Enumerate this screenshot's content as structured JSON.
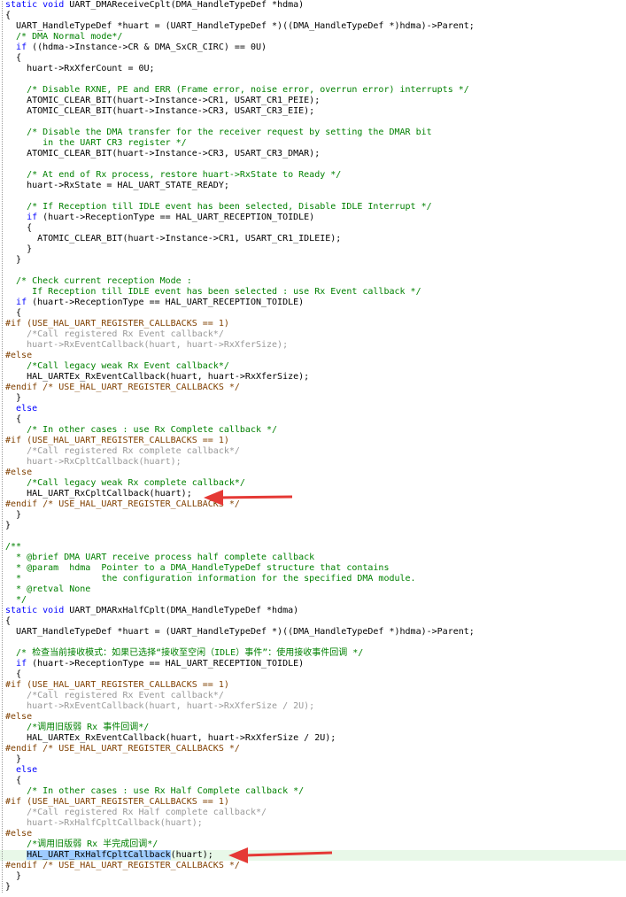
{
  "editor": {
    "lines": [
      {
        "t": "static void UART_DMAReceiveCplt(DMA_HandleTypeDef *hdma)",
        "c": "kw"
      },
      {
        "t": "{",
        "c": ""
      },
      {
        "t": "  UART_HandleTypeDef *huart = (UART_HandleTypeDef *)((DMA_HandleTypeDef *)hdma)->Parent;",
        "c": ""
      },
      {
        "t": "  /* DMA Normal mode*/",
        "c": "cm"
      },
      {
        "t": "  if ((hdma->Instance->CR & DMA_SxCR_CIRC) == 0U)",
        "c": "kw"
      },
      {
        "t": "  {",
        "c": ""
      },
      {
        "t": "    huart->RxXferCount = 0U;",
        "c": ""
      },
      {
        "t": "",
        "c": ""
      },
      {
        "t": "    /* Disable RXNE, PE and ERR (Frame error, noise error, overrun error) interrupts */",
        "c": "cm"
      },
      {
        "t": "    ATOMIC_CLEAR_BIT(huart->Instance->CR1, USART_CR1_PEIE);",
        "c": ""
      },
      {
        "t": "    ATOMIC_CLEAR_BIT(huart->Instance->CR3, USART_CR3_EIE);",
        "c": ""
      },
      {
        "t": "",
        "c": ""
      },
      {
        "t": "    /* Disable the DMA transfer for the receiver request by setting the DMAR bit",
        "c": "cm"
      },
      {
        "t": "       in the UART CR3 register */",
        "c": "cm"
      },
      {
        "t": "    ATOMIC_CLEAR_BIT(huart->Instance->CR3, USART_CR3_DMAR);",
        "c": ""
      },
      {
        "t": "",
        "c": ""
      },
      {
        "t": "    /* At end of Rx process, restore huart->RxState to Ready */",
        "c": "cm"
      },
      {
        "t": "    huart->RxState = HAL_UART_STATE_READY;",
        "c": ""
      },
      {
        "t": "",
        "c": ""
      },
      {
        "t": "    /* If Reception till IDLE event has been selected, Disable IDLE Interrupt */",
        "c": "cm"
      },
      {
        "t": "    if (huart->ReceptionType == HAL_UART_RECEPTION_TOIDLE)",
        "c": "kw"
      },
      {
        "t": "    {",
        "c": ""
      },
      {
        "t": "      ATOMIC_CLEAR_BIT(huart->Instance->CR1, USART_CR1_IDLEIE);",
        "c": ""
      },
      {
        "t": "    }",
        "c": ""
      },
      {
        "t": "  }",
        "c": ""
      },
      {
        "t": "",
        "c": ""
      },
      {
        "t": "  /* Check current reception Mode :",
        "c": "cm"
      },
      {
        "t": "     If Reception till IDLE event has been selected : use Rx Event callback */",
        "c": "cm"
      },
      {
        "t": "  if (huart->ReceptionType == HAL_UART_RECEPTION_TOIDLE)",
        "c": "kw"
      },
      {
        "t": "  {",
        "c": ""
      },
      {
        "t": "#if (USE_HAL_UART_REGISTER_CALLBACKS == 1)",
        "c": "pp"
      },
      {
        "t": "    /*Call registered Rx Event callback*/",
        "c": "inactive"
      },
      {
        "t": "    huart->RxEventCallback(huart, huart->RxXferSize);",
        "c": "inactive"
      },
      {
        "t": "#else",
        "c": "pp"
      },
      {
        "t": "    /*Call legacy weak Rx Event callback*/",
        "c": "cm"
      },
      {
        "t": "    HAL_UARTEx_RxEventCallback(huart, huart->RxXferSize);",
        "c": ""
      },
      {
        "t": "#endif /* USE_HAL_UART_REGISTER_CALLBACKS */",
        "c": "pp"
      },
      {
        "t": "  }",
        "c": ""
      },
      {
        "t": "  else",
        "c": "kw"
      },
      {
        "t": "  {",
        "c": ""
      },
      {
        "t": "    /* In other cases : use Rx Complete callback */",
        "c": "cm"
      },
      {
        "t": "#if (USE_HAL_UART_REGISTER_CALLBACKS == 1)",
        "c": "pp"
      },
      {
        "t": "    /*Call registered Rx complete callback*/",
        "c": "inactive"
      },
      {
        "t": "    huart->RxCpltCallback(huart);",
        "c": "inactive"
      },
      {
        "t": "#else",
        "c": "pp"
      },
      {
        "t": "    /*Call legacy weak Rx complete callback*/",
        "c": "cm"
      },
      {
        "t": "    HAL_UART_RxCpltCallback(huart);",
        "c": ""
      },
      {
        "t": "#endif /* USE_HAL_UART_REGISTER_CALLBACKS */",
        "c": "pp"
      },
      {
        "t": "  }",
        "c": ""
      },
      {
        "t": "}",
        "c": ""
      },
      {
        "t": "",
        "c": ""
      },
      {
        "t": "/**",
        "c": "cm"
      },
      {
        "t": "  * @brief DMA UART receive process half complete callback",
        "c": "cm"
      },
      {
        "t": "  * @param  hdma  Pointer to a DMA_HandleTypeDef structure that contains",
        "c": "cm"
      },
      {
        "t": "  *               the configuration information for the specified DMA module.",
        "c": "cm"
      },
      {
        "t": "  * @retval None",
        "c": "cm"
      },
      {
        "t": "  */",
        "c": "cm"
      },
      {
        "t": "static void UART_DMARxHalfCplt(DMA_HandleTypeDef *hdma)",
        "c": "kw"
      },
      {
        "t": "{",
        "c": ""
      },
      {
        "t": "  UART_HandleTypeDef *huart = (UART_HandleTypeDef *)((DMA_HandleTypeDef *)hdma)->Parent;",
        "c": ""
      },
      {
        "t": "",
        "c": ""
      },
      {
        "t": "  /* 检查当前接收模式：如果已选择“接收至空闲（IDLE）事件”：使用接收事件回调 */",
        "c": "cm"
      },
      {
        "t": "  if (huart->ReceptionType == HAL_UART_RECEPTION_TOIDLE)",
        "c": "kw"
      },
      {
        "t": "  {",
        "c": ""
      },
      {
        "t": "#if (USE_HAL_UART_REGISTER_CALLBACKS == 1)",
        "c": "pp"
      },
      {
        "t": "    /*Call registered Rx Event callback*/",
        "c": "inactive"
      },
      {
        "t": "    huart->RxEventCallback(huart, huart->RxXferSize / 2U);",
        "c": "inactive"
      },
      {
        "t": "#else",
        "c": "pp"
      },
      {
        "t": "    /*调用旧版弱 Rx 事件回调*/",
        "c": "cm"
      },
      {
        "t": "    HAL_UARTEx_RxEventCallback(huart, huart->RxXferSize / 2U);",
        "c": ""
      },
      {
        "t": "#endif /* USE_HAL_UART_REGISTER_CALLBACKS */",
        "c": "pp"
      },
      {
        "t": "  }",
        "c": ""
      },
      {
        "t": "  else",
        "c": "kw"
      },
      {
        "t": "  {",
        "c": ""
      },
      {
        "t": "    /* In other cases : use Rx Half Complete callback */",
        "c": "cm"
      },
      {
        "t": "#if (USE_HAL_UART_REGISTER_CALLBACKS == 1)",
        "c": "pp"
      },
      {
        "t": "    /*Call registered Rx Half complete callback*/",
        "c": "inactive"
      },
      {
        "t": "    huart->RxHalfCpltCallback(huart);",
        "c": "inactive"
      },
      {
        "t": "#else",
        "c": "pp"
      },
      {
        "t": "    /*调用旧版弱 Rx 半完成回调*/",
        "c": "cm"
      },
      {
        "t": "    HAL_UART_RxHalfCpltCallback(huart);",
        "c": "",
        "highlight": true
      },
      {
        "t": "#endif /* USE_HAL_UART_REGISTER_CALLBACKS */",
        "c": "pp"
      },
      {
        "t": "  }",
        "c": ""
      },
      {
        "t": "}",
        "c": ""
      }
    ],
    "selected_text": "HAL_UART_RxHalfCpltCallback",
    "colors": {
      "keyword": "#0000ff",
      "comment": "#008000",
      "preprocessor": "#804000",
      "inactive": "#999999",
      "current_line": "#e8f8e8",
      "selection": "#9ecbff",
      "arrow": "#e53935"
    }
  },
  "annotations": [
    {
      "name": "arrow-rxcplt",
      "points_to_line": 46
    },
    {
      "name": "arrow-rxhalfcplt",
      "points_to_line": 80
    }
  ]
}
